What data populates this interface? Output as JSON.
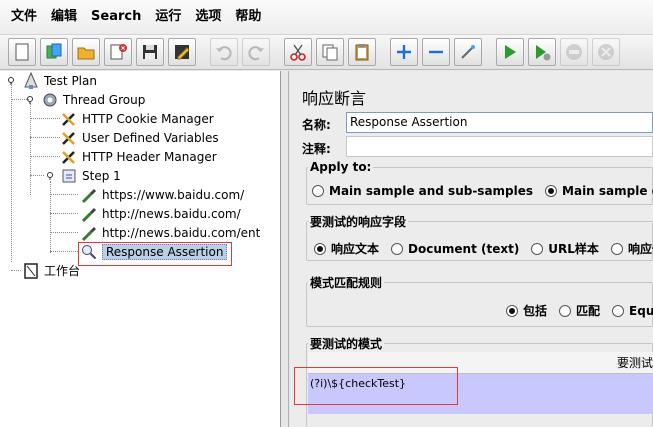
{
  "menu": [
    "文件",
    "编辑",
    "Search",
    "运行",
    "选项",
    "帮助"
  ],
  "tree": {
    "test_plan": "Test Plan",
    "thread_group": "Thread Group",
    "cookie_manager": "HTTP Cookie Manager",
    "user_vars": "User Defined Variables",
    "header_manager": "HTTP Header Manager",
    "step1": "Step 1",
    "sampler1": "https://www.baidu.com/",
    "sampler2": "http://news.baidu.com/",
    "sampler3": "http://news.baidu.com/ent",
    "assertion": "Response Assertion",
    "workbench": "工作台"
  },
  "panel": {
    "title": "响应断言",
    "name_label": "名称:",
    "name_value": "Response Assertion",
    "comment_label": "注释:",
    "comment_value": "",
    "apply_to": {
      "legend": "Apply to:",
      "options": [
        "Main sample and sub-samples",
        "Main sample only"
      ],
      "selected": "Main sample only"
    },
    "response_field": {
      "legend": "要测试的响应字段",
      "options": [
        "响应文本",
        "Document (text)",
        "URL样本",
        "响应代"
      ],
      "selected": "响应文本"
    },
    "match_rule": {
      "legend": "模式匹配规则",
      "options": [
        "包括",
        "匹配",
        "Equ"
      ],
      "selected": "包括"
    },
    "patterns": {
      "legend": "要测试的模式",
      "column_header": "要测试",
      "rows": [
        "(?i)\\${checkTest}"
      ]
    }
  }
}
